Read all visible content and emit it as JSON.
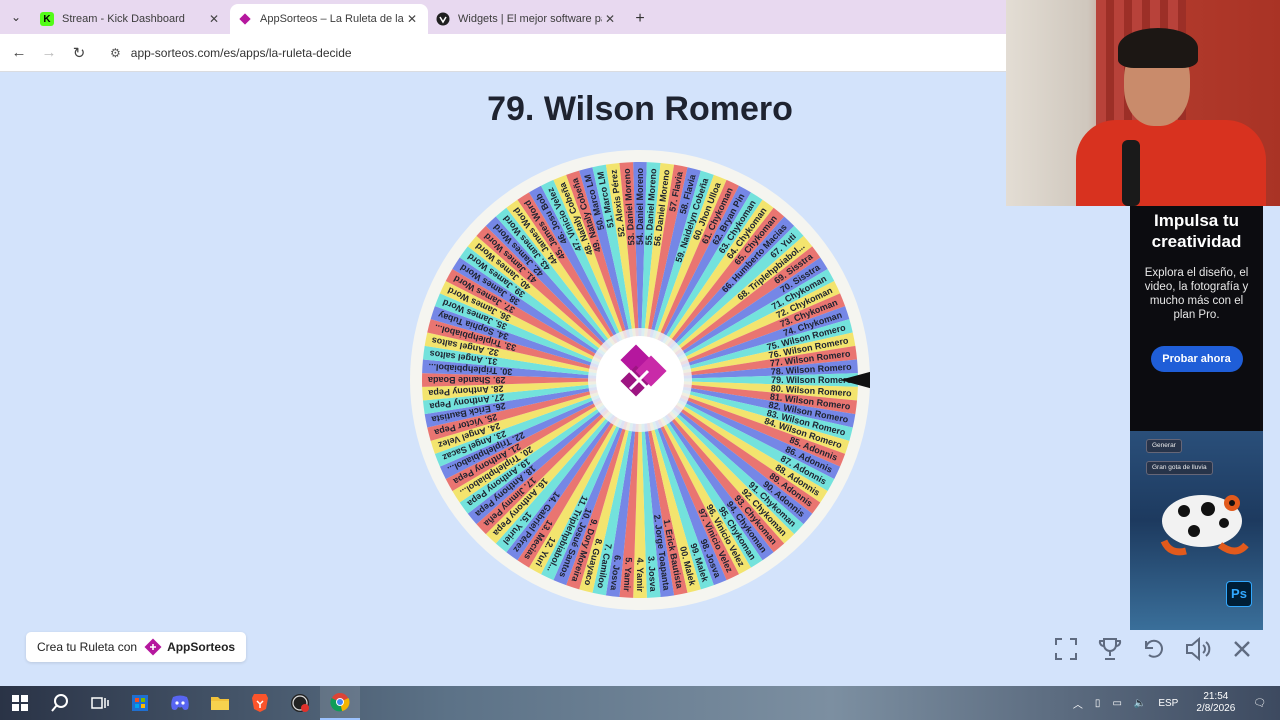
{
  "browser": {
    "tabs": [
      {
        "title": "Stream - Kick Dashboard",
        "favicon_color": "#53fc18",
        "favicon_glyph": "K",
        "active": false
      },
      {
        "title": "AppSorteos – La Ruleta de la Su",
        "favicon_color": "#b5179e",
        "favicon_glyph": "",
        "active": true
      },
      {
        "title": "Widgets | El mejor software par",
        "favicon_color": "#202020",
        "favicon_glyph": "",
        "active": false
      }
    ],
    "url": "app-sorteos.com/es/apps/la-ruleta-decide"
  },
  "result": {
    "title": "79. Wilson Romero"
  },
  "wheel": {
    "selected_index": 78,
    "colors": [
      "#e97571",
      "#7587e6",
      "#73e2dc",
      "#f3e46e"
    ],
    "logo_colors": [
      "#b5179e",
      "#7b2cbf"
    ],
    "entries": [
      "1. Erick Bautista",
      "2. Jorge Toapanta",
      "3. Josva",
      "4. Yamir",
      "5. Yamir",
      "6. Josva",
      "7. Camiloo",
      "8. Guayaco",
      "9. Dory Moreira",
      "10. Josué Santos",
      "11. Triplehpbiabol...",
      "12. Yuri",
      "13. Mecias",
      "14. Gabriel Pérez",
      "15. Yuriel",
      "16. Anthony Pepa",
      "17. Jimmy Peña",
      "18. Anthony Pepa",
      "19. Anthony Pepa",
      "20. Triplehpbiabol...",
      "21. Anthony Pepa",
      "22. Triplehpbiabol...",
      "23. Angel Sacaz",
      "24. Angel Velez",
      "25. Victor Pepa",
      "26. Erick Bautista",
      "27. Anthony Pepa",
      "28. Anthony Pepa",
      "29. Shande Boada",
      "30. Triplehpbiabol...",
      "31. Angel saltos",
      "32. Angel saltos",
      "33. Triplehpbiabol...",
      "34. Sophia Tubay",
      "35. James Word",
      "36. James Word",
      "37. James Word",
      "38. James Word",
      "39. James Word",
      "40. James Word",
      "41. James Word",
      "42. James Word",
      "43. James Word",
      "44. James Word",
      "45. James Word",
      "46. Josu Bob",
      "47. Vinicio Velez",
      "48. Nataly Cobeña",
      "49. Nataly Cobeña",
      "50. Marco LM",
      "51. Marco LM",
      "52. Alexis Pérez",
      "53. Daniel Moreno",
      "54. Daniel Moreno",
      "55. Daniel Moreno",
      "56. Daniel Moreno",
      "57. Flavia",
      "58. Flavia",
      "59. Naidelyn Cobeña",
      "60. Jhon Ulloa",
      "61. Chykoman",
      "62. Bryan Pin",
      "63. Chykoman",
      "64. Chykoman",
      "65. Chykoman",
      "66. Humberto Macias",
      "67. Yuti",
      "68. Triplehpbiabol...",
      "69. Sisstra",
      "70. Sisstra",
      "71. Chykoman",
      "72. Chykoman",
      "73. Chykoman",
      "74. Chykoman",
      "75. Wilson Romero",
      "76. Wilson Romero",
      "77. Wilson Romero",
      "78. Wilson Romero",
      "79. Wilson Romero",
      "80. Wilson Romero",
      "81. Wilson Romero",
      "82. Wilson Romero",
      "83. Wilson Romero",
      "84. Wilson Romero",
      "85. Adonnis",
      "86. Adonnis",
      "87. Adonnis",
      "88. Adonnis",
      "89. Adonnis",
      "90. Adonnis",
      "91. Chykoman",
      "92. Chykoman",
      "93. Chykoman",
      "94. Chykoman",
      "95. Chykoman",
      "96. Vinicio Velez",
      "97. Vinicio Velez",
      "98. Josva",
      "99. Malek",
      "00. Malek"
    ]
  },
  "credit": {
    "prefix": "Crea tu Ruleta con",
    "brand": "AppSorteos"
  },
  "controls": [
    {
      "name": "fullscreen-icon"
    },
    {
      "name": "trophy-icon"
    },
    {
      "name": "reset-icon"
    },
    {
      "name": "volume-icon"
    },
    {
      "name": "close-icon"
    }
  ],
  "ad": {
    "title": "Impulsa tu creatividad",
    "body": "Explora el diseño, el video, la fotografía y mucho más con el plan Pro.",
    "button": "Probar ahora",
    "chip1": "Generar",
    "chip2": "Gran gota de lluvia",
    "badge": "Ps",
    "brand_color": "#1f5ed8"
  },
  "taskbar": {
    "lang": "ESP",
    "time": "21:54",
    "date": "2/8/2026"
  }
}
